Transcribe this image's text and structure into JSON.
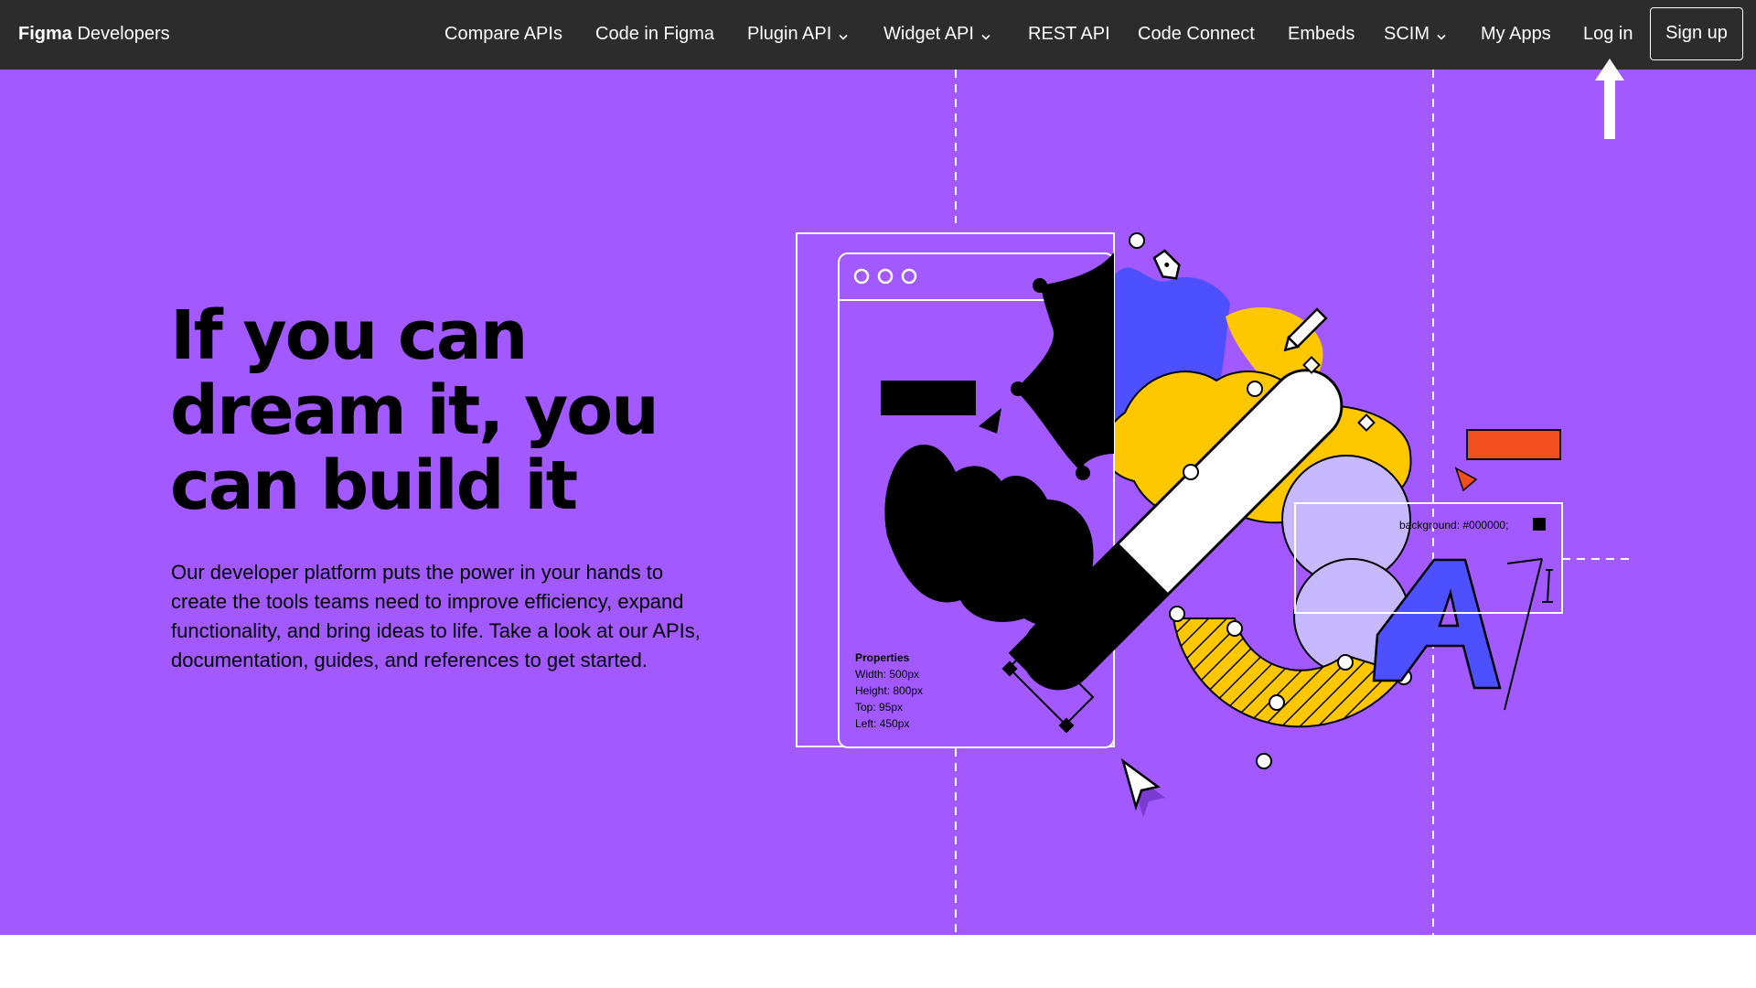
{
  "nav": {
    "brand_bold": "Figma",
    "brand_rest": "Developers",
    "links": [
      {
        "label": "Compare APIs"
      },
      {
        "label": "Code in Figma"
      },
      {
        "label": "Plugin API"
      },
      {
        "label": "Widget API"
      },
      {
        "label": "REST API"
      },
      {
        "label": "Code Connect"
      },
      {
        "label": "Embeds"
      },
      {
        "label": "SCIM"
      },
      {
        "label": "My Apps"
      },
      {
        "label": "Log in"
      }
    ],
    "signup": "Sign up"
  },
  "hero": {
    "headline": "If you can dream it, you can build it",
    "description": "Our developer platform puts the power in your hands to create the tools teams need to improve efficiency, expand functionality, and bring ideas to life. Take a look at our APIs, documentation, guides, and references to get started."
  },
  "illustration": {
    "properties_title": "Properties",
    "prop_width": "Width: 500px",
    "prop_height": "Height: 800px",
    "prop_top": "Top: 95px",
    "prop_left": "Left: 450px",
    "code_label": "background: #000000;"
  },
  "colors": {
    "nav_bg": "#2c2c2c",
    "hero_bg": "#a259ff",
    "blue": "#4d50ff",
    "yellow": "#ffc700",
    "orange": "#f24e1e",
    "lavender": "#c7b9ff"
  }
}
